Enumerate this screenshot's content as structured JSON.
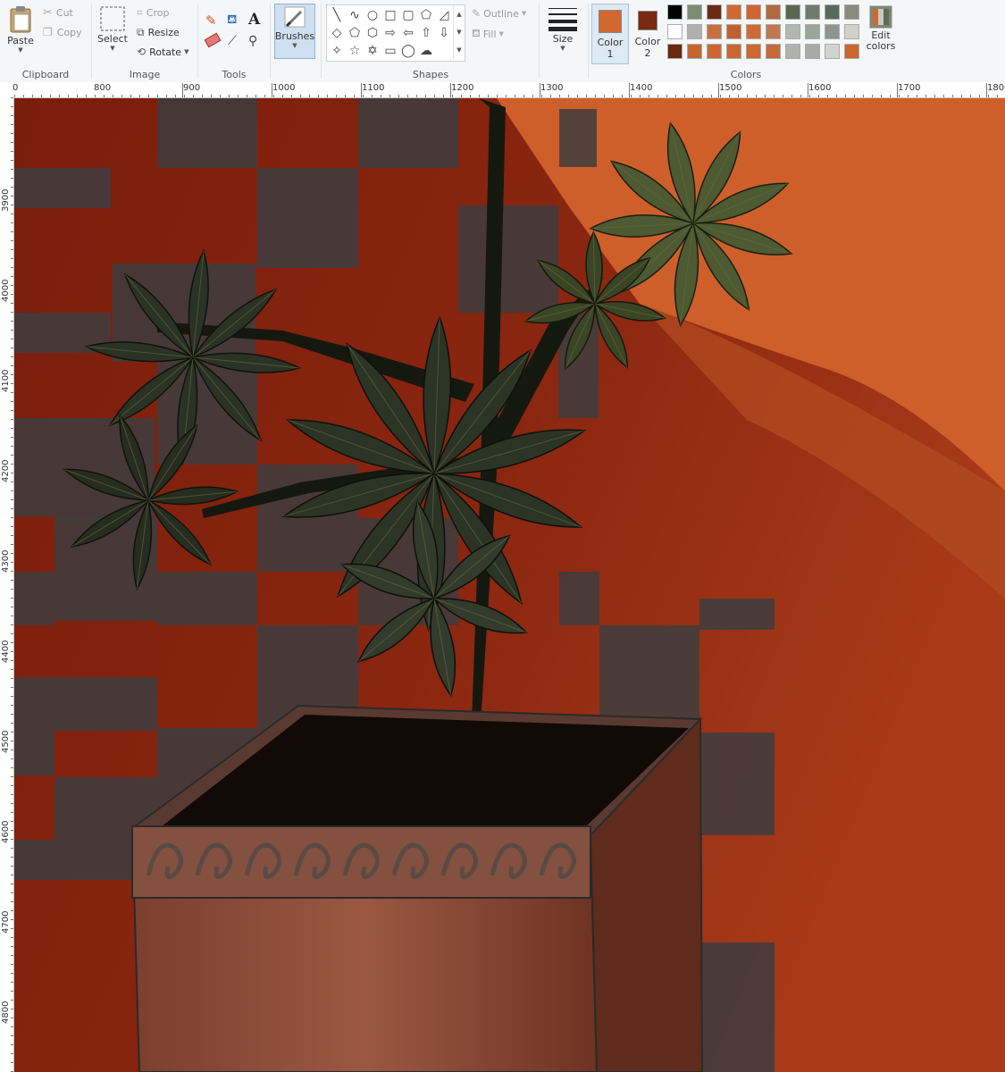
{
  "clipboard": {
    "label": "Clipboard",
    "paste_label": "Paste",
    "cut_label": "Cut",
    "copy_label": "Copy"
  },
  "image": {
    "label": "Image",
    "select_label": "Select",
    "crop_label": "Crop",
    "resize_label": "Resize",
    "rotate_label": "Rotate"
  },
  "tools": {
    "label": "Tools",
    "items": [
      "pencil-icon",
      "fill-bucket-icon",
      "text-icon",
      "eraser-icon",
      "color-picker-icon",
      "magnifier-icon"
    ]
  },
  "brushes": {
    "label": "Brushes"
  },
  "shapes": {
    "label": "Shapes",
    "outline_label": "Outline",
    "fill_label": "Fill",
    "glyphs": [
      "╲",
      "∿",
      "○",
      "□",
      "▢",
      "⬠",
      "◿",
      "◇",
      "⬠",
      "⬡",
      "⇨",
      "⇦",
      "⇧",
      "⇩",
      "✧",
      "☆",
      "✡",
      "▭",
      "◯",
      "☁"
    ]
  },
  "size": {
    "label": "Size"
  },
  "colors": {
    "label": "Colors",
    "color1_label": "Color",
    "color1_num": "1",
    "color2_label": "Color",
    "color2_num": "2",
    "color1_value": "#d2672f",
    "color2_value": "#7a2a10",
    "edit_label": "Edit",
    "edit_label2": "colors",
    "palette": [
      [
        "#000000",
        "#7d8c76",
        "#6d2a12",
        "#d06832",
        "#cf6630",
        "#b06a3e",
        "#5a6852",
        "#6f7a6c",
        "#5a6a5a",
        "#8a8a7e"
      ],
      [
        "#ffffff",
        "#b0b0b0",
        "#c8703e",
        "#c06030",
        "#d06a34",
        "#c07850",
        "#b0b8b0",
        "#9aa69a",
        "#8c968c",
        "#d0d0cc"
      ],
      [
        "#6a2810",
        "#c66532",
        "#cc6733",
        "#cb6633",
        "#cf6732",
        "#c56a3a",
        "#aeb2ae",
        "#a8aaa8",
        "#d0d4d0",
        "#cc6630"
      ]
    ]
  },
  "ruler": {
    "x_labels": [
      "900",
      "1000",
      "1100",
      "1200",
      "1300",
      "1400",
      "1500",
      "1600",
      "1700",
      "1800"
    ],
    "x_first": "800",
    "y_labels": [
      "3900",
      "4000",
      "4100",
      "4200",
      "4300",
      "4400",
      "4500",
      "4600",
      "4700",
      "4800"
    ]
  },
  "canvas": {
    "wall_color": "#7e1f0c",
    "wall_light": "#d0602c",
    "check_color": "#3d3d40",
    "pot_color": "#8a4a35",
    "leaf_dark": "#2a3325",
    "leaf_light": "#4d5a32"
  }
}
